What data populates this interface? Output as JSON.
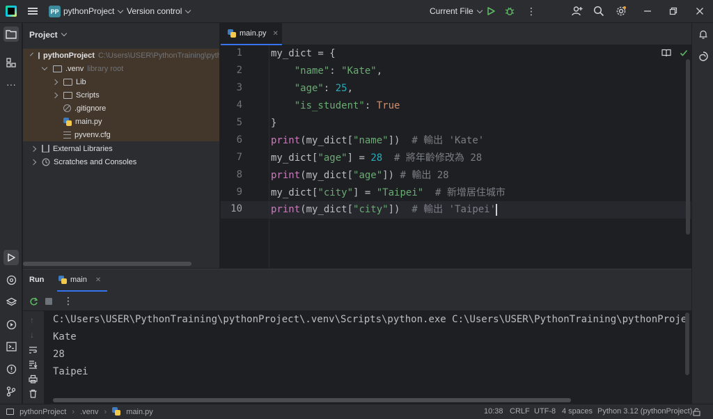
{
  "titlebar": {
    "project_badge": "PP",
    "project_name": "pythonProject",
    "vcs_label": "Version control",
    "run_config": "Current File"
  },
  "project_panel": {
    "title": "Project",
    "tree": [
      {
        "label": "pythonProject",
        "hint": "C:\\Users\\USER\\PythonTraining\\pythonProject",
        "icon": "folder-icon",
        "expanded": true
      },
      {
        "label": ".venv",
        "hint": "library root",
        "icon": "folder-icon",
        "expanded": true
      },
      {
        "label": "Lib",
        "hint": "",
        "icon": "folder-icon",
        "expanded": false
      },
      {
        "label": "Scripts",
        "hint": "",
        "icon": "folder-icon",
        "expanded": false
      },
      {
        "label": ".gitignore",
        "hint": "",
        "icon": "ignore-file-icon"
      },
      {
        "label": "main.py",
        "hint": "",
        "icon": "python-file-icon"
      },
      {
        "label": "pyvenv.cfg",
        "hint": "",
        "icon": "config-file-icon"
      },
      {
        "label": "External Libraries",
        "hint": "",
        "icon": "library-icon",
        "expanded": false
      },
      {
        "label": "Scratches and Consoles",
        "hint": "",
        "icon": "scratches-icon",
        "expanded": false
      }
    ]
  },
  "editor": {
    "tab_label": "main.py",
    "line_numbers": [
      "1",
      "2",
      "3",
      "4",
      "5",
      "6",
      "7",
      "8",
      "9",
      "10"
    ],
    "current_line": 10
  },
  "run_panel": {
    "title": "Run",
    "tab_label": "main",
    "output": [
      "C:\\Users\\USER\\PythonTraining\\pythonProject\\.venv\\Scripts\\python.exe C:\\Users\\USER\\PythonTraining\\pythonProject\\main.py",
      "Kate",
      "28",
      "Taipei"
    ]
  },
  "statusbar": {
    "breadcrumb": [
      "pythonProject",
      ".venv",
      "main.py"
    ],
    "position": "10:38",
    "line_sep": "CRLF",
    "encoding": "UTF-8",
    "indent": "4 spaces",
    "interpreter": "Python 3.12 (pythonProject)"
  },
  "colors": {
    "background": "#1e1f22",
    "panel": "#2b2d30",
    "accent": "#3574f0",
    "string": "#6aab73",
    "number": "#2aacb8",
    "keyword": "#cf8e6d",
    "builtin": "#c77dbb",
    "comment": "#7a7e85"
  },
  "code": {
    "l1": {
      "a": "my_dict = {"
    },
    "l2": {
      "indent": "    ",
      "s1": "\"name\"",
      "p1": ": ",
      "s2": "\"Kate\"",
      "p2": ","
    },
    "l3": {
      "indent": "    ",
      "s1": "\"age\"",
      "p1": ": ",
      "n1": "25",
      "p2": ","
    },
    "l4": {
      "indent": "    ",
      "s1": "\"is_student\"",
      "p1": ": ",
      "k1": "True"
    },
    "l5": {
      "a": "}"
    },
    "l6": {
      "f": "print",
      "a": "(my_dict[",
      "s1": "\"name\"",
      "b": "])  ",
      "c": "# 輸出 'Kate'"
    },
    "l7": {
      "a": "my_dict[",
      "s1": "\"age\"",
      "b": "] = ",
      "n1": "28",
      "sp": "  ",
      "c": "# 將年齡修改為 28"
    },
    "l8": {
      "f": "print",
      "a": "(my_dict[",
      "s1": "\"age\"",
      "b": "]) ",
      "c": "# 輸出 28"
    },
    "l9": {
      "a": "my_dict[",
      "s1": "\"city\"",
      "b": "] = ",
      "s2": "\"Taipei\"",
      "sp": "  ",
      "c": "# 新增居住城市"
    },
    "l10": {
      "f": "print",
      "a": "(my_dict[",
      "s1": "\"city\"",
      "b": "])  ",
      "c": "# 輸出 'Taipei'"
    }
  }
}
